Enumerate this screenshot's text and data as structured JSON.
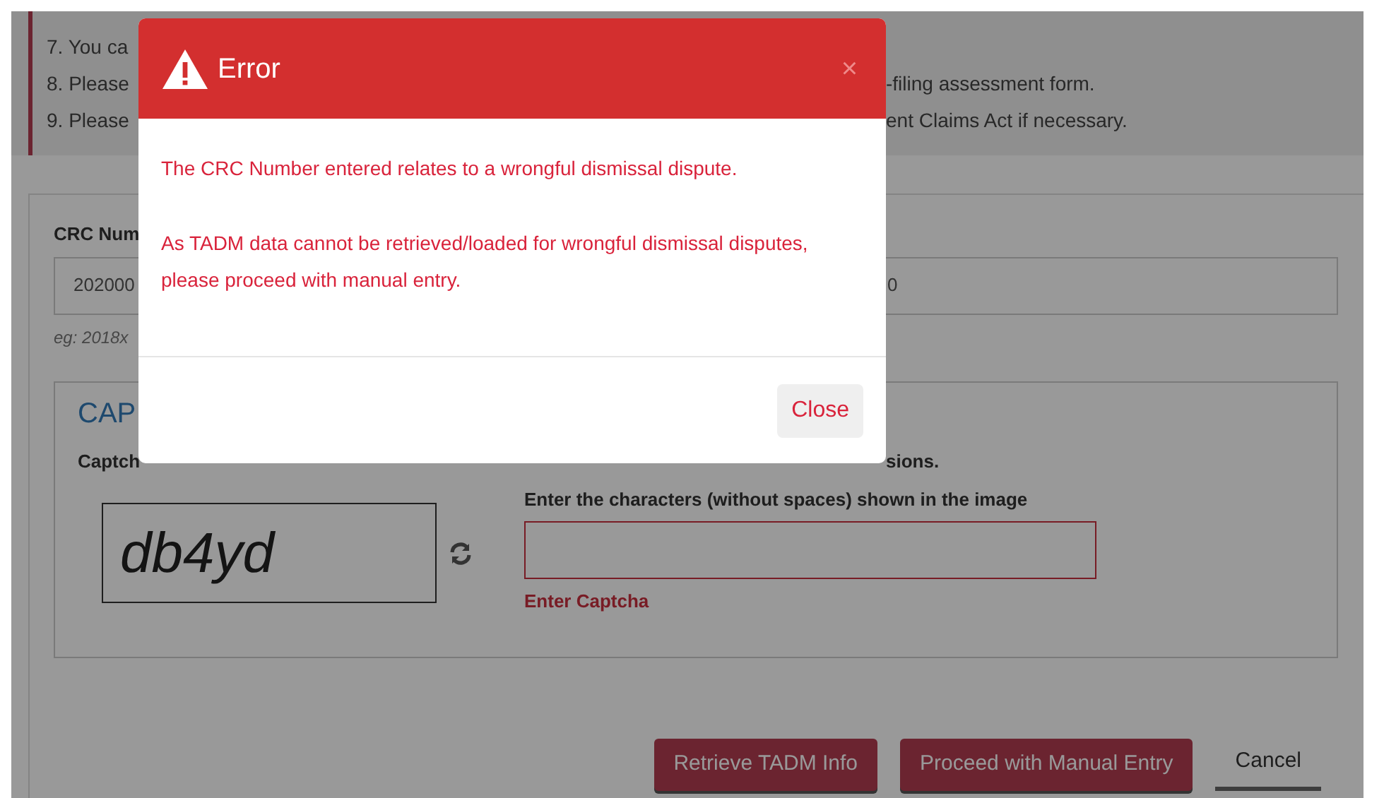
{
  "notes": [
    {
      "text": "7. You ca"
    },
    {
      "text": "8. Please",
      "continued": "-filing assessment form."
    },
    {
      "text": "9. Please",
      "continued": "ent Claims Act if necessary."
    }
  ],
  "form": {
    "crc_label": "CRC Num",
    "crc_value_start": "202000",
    "crc_value_end": "0",
    "hint": "eg: 2018x",
    "captcha": {
      "title": "CAP",
      "label_start": "Captch",
      "label_end": "sions.",
      "image_text": "db4yd",
      "instruction": "Enter the characters (without spaces) shown in the image",
      "invalid": true,
      "error": "Enter Captcha"
    }
  },
  "buttons": [
    {
      "label": "Retrieve TADM Info",
      "kind": "primary"
    },
    {
      "label": "Proceed with Manual Entry",
      "kind": "primary"
    },
    {
      "label": "Cancel",
      "kind": "link"
    }
  ],
  "modal": {
    "title": "Error",
    "close": "×",
    "messages": [
      "The CRC Number entered relates to a wrongful dismissal dispute.",
      "As TADM data cannot be retrieved/loaded for wrongful dismissal disputes, please proceed with manual entry."
    ],
    "footer_button": "Close"
  }
}
